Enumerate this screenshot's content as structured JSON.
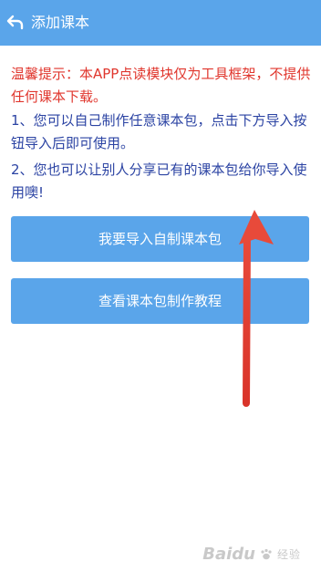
{
  "header": {
    "back_icon": "back-arrow-icon",
    "title": "添加课本"
  },
  "content": {
    "notice": "温馨提示：本APP点读模块仅为工具框架，不提供任何课本下载。",
    "para1": "1、您可以自己制作任意课本包，点击下方导入按钮导入后即可使用。",
    "para2": "2、您也可以让别人分享已有的课本包给你导入使用噢!"
  },
  "buttons": {
    "import_label": "我要导入自制课本包",
    "tutorial_label": "查看课本包制作教程"
  },
  "watermark": {
    "logo": "Baidu",
    "sub": "经验"
  },
  "colors": {
    "primary": "#5aa5ea",
    "notice_text": "#e0362d",
    "body_text": "#2b43a3",
    "annotation_arrow": "#e74c3c"
  }
}
